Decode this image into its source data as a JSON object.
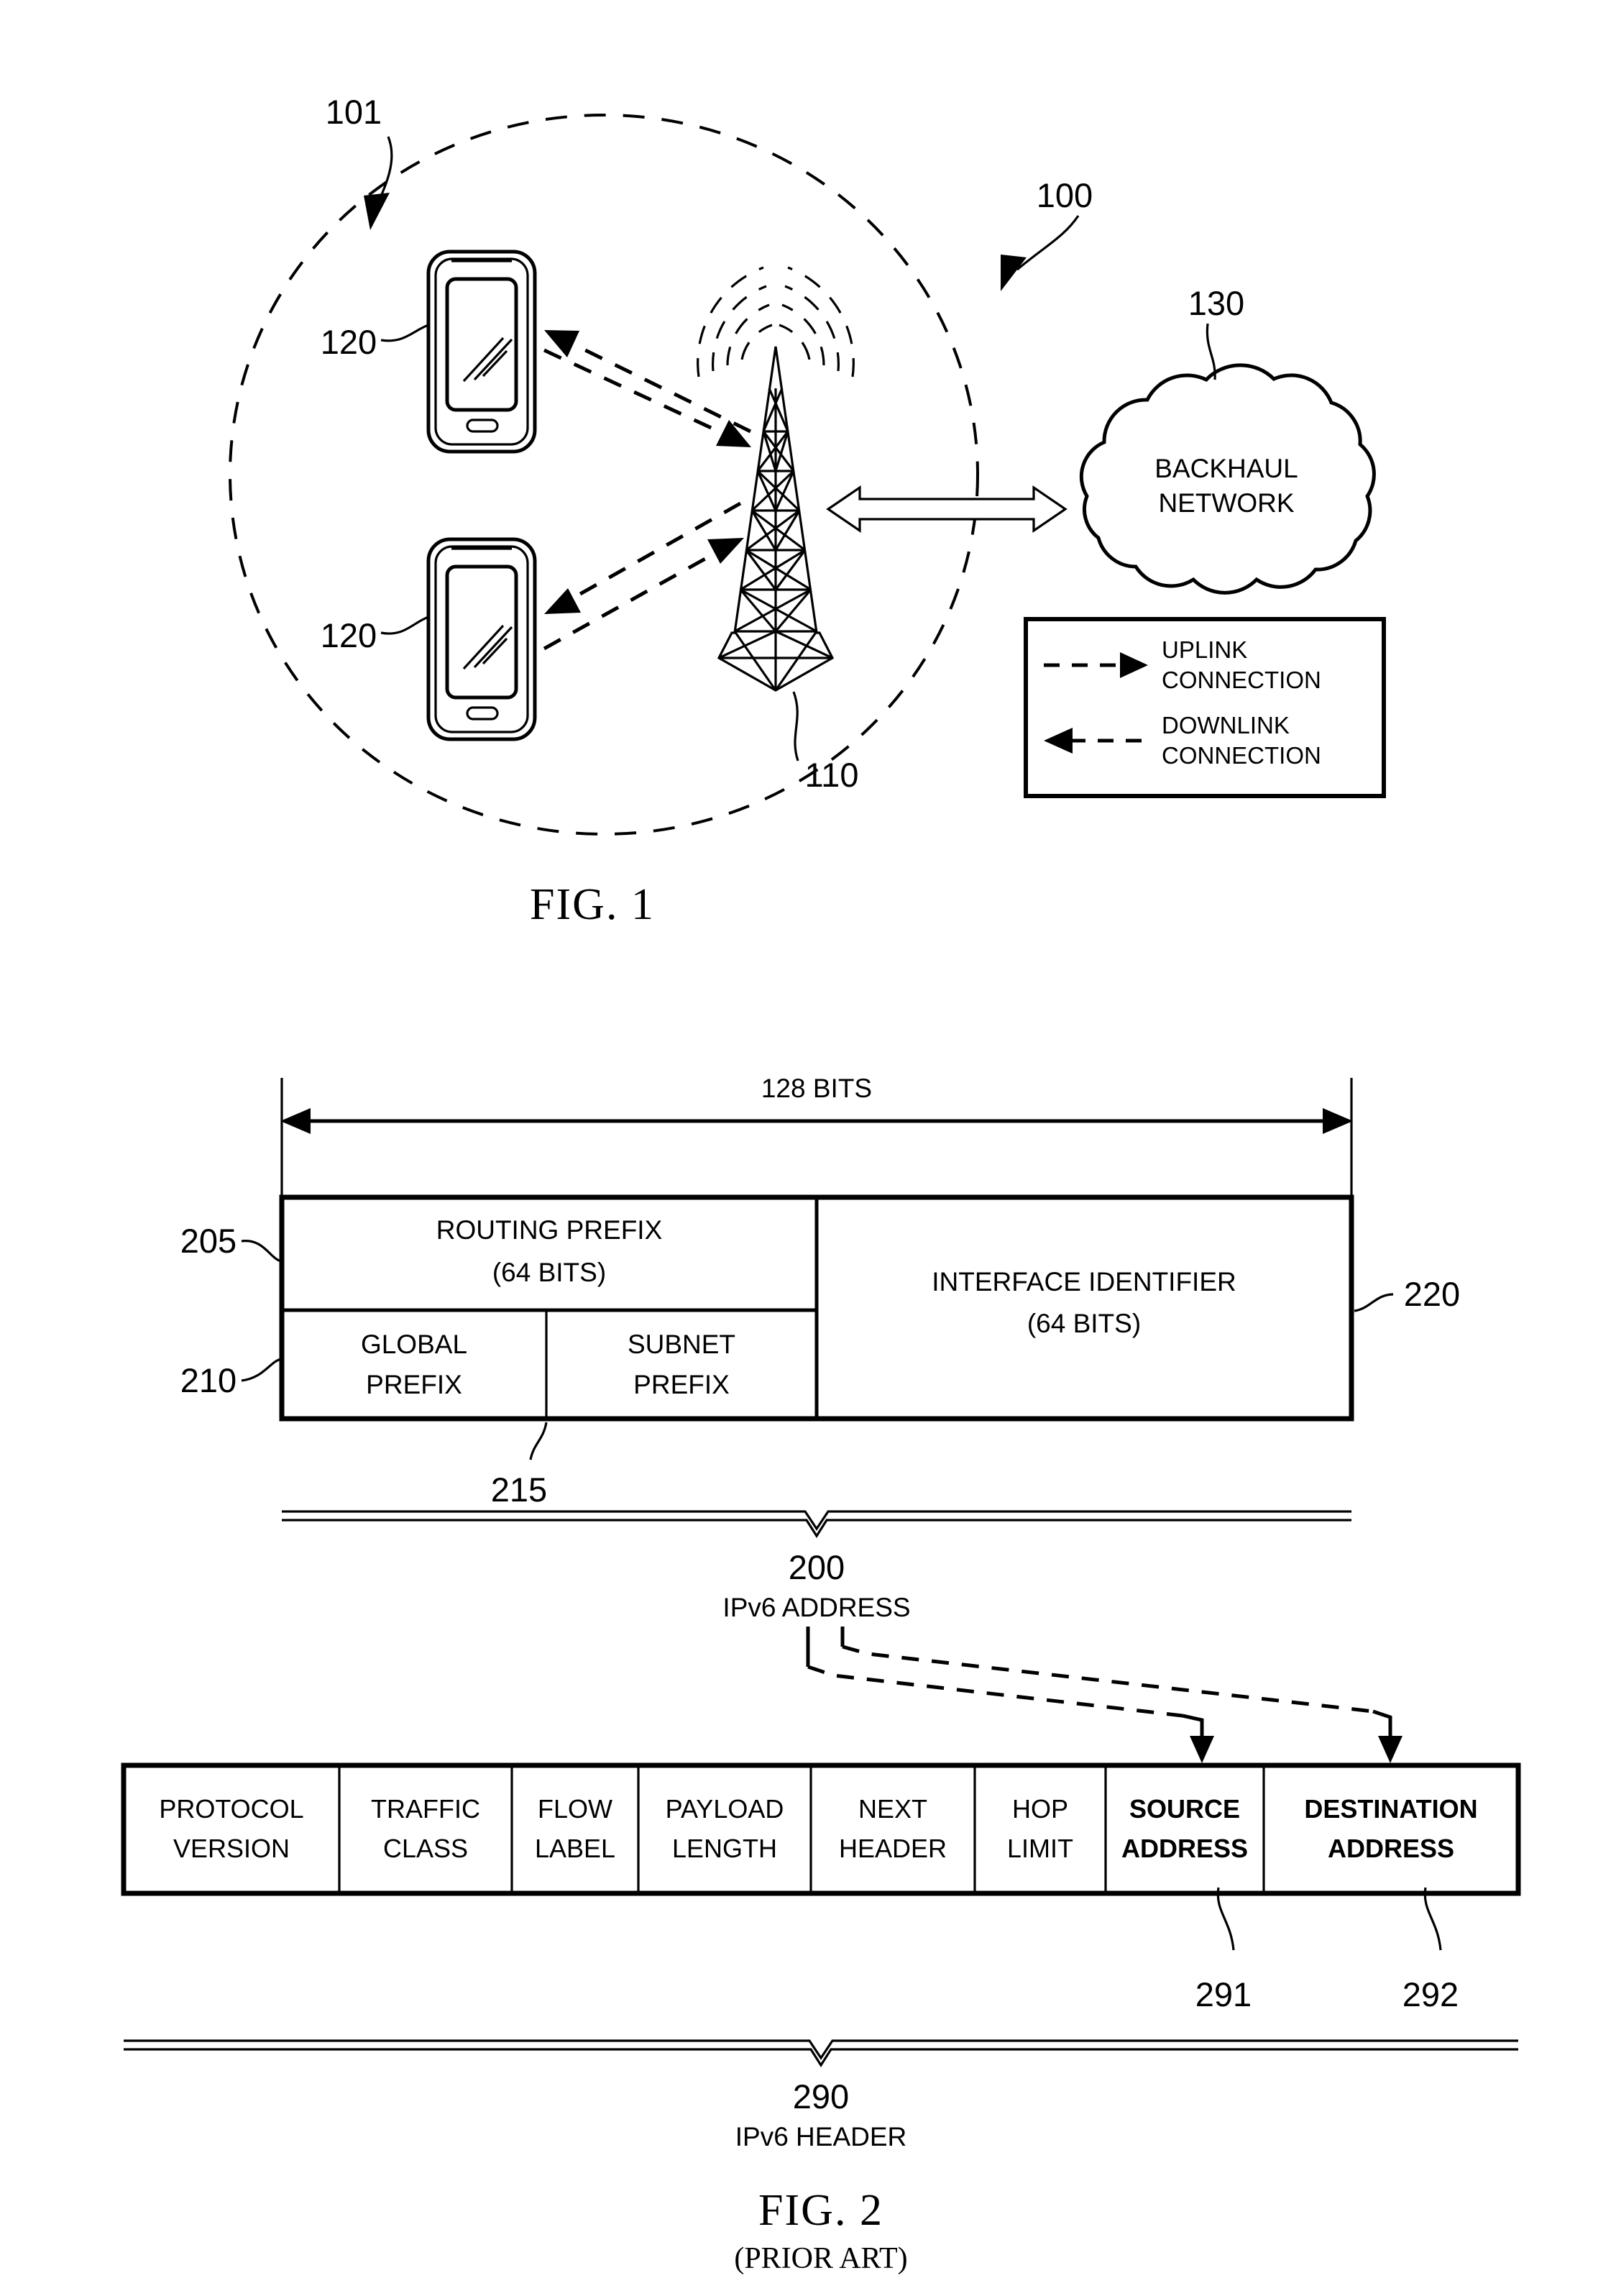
{
  "document": {
    "type": "patent-drawing-sheet",
    "figures": [
      {
        "id": "fig1",
        "caption": "FIG. 1",
        "subcaption": ""
      },
      {
        "id": "fig2",
        "caption": "FIG. 2",
        "subcaption": "(PRIOR ART)"
      }
    ]
  },
  "fig1": {
    "caption": "FIG. 1",
    "reference_numerals": {
      "system": "100",
      "cell_coverage": "101",
      "base_station": "110",
      "user_equipment_top": "120",
      "user_equipment_bottom": "120",
      "backhaul": "130"
    },
    "cloud_label_line1": "BACKHAUL",
    "cloud_label_line2": "NETWORK",
    "legend": {
      "items": [
        {
          "line1": "UPLINK",
          "line2": "CONNECTION",
          "direction": "right"
        },
        {
          "line1": "DOWNLINK",
          "line2": "CONNECTION",
          "direction": "left"
        }
      ]
    }
  },
  "fig2": {
    "caption": "FIG. 2",
    "subcaption": "(PRIOR ART)",
    "dimension_label": "128 BITS",
    "address_block": {
      "reference_numerals": {
        "routing_prefix": "205",
        "global_prefix": "210",
        "subnet_prefix": "215",
        "interface_identifier": "220",
        "whole": "200"
      },
      "cells": {
        "routing_prefix_line1": "ROUTING PREFIX",
        "routing_prefix_line2": "(64 BITS)",
        "global_prefix_line1": "GLOBAL",
        "global_prefix_line2": "PREFIX",
        "subnet_prefix_line1": "SUBNET",
        "subnet_prefix_line2": "PREFIX",
        "interface_id_line1": "INTERFACE IDENTIFIER",
        "interface_id_line2": "(64 BITS)"
      },
      "brace_number": "200",
      "brace_label": "IPv6 ADDRESS"
    },
    "header_block": {
      "brace_number": "290",
      "brace_label": "IPv6 HEADER",
      "reference_numerals": {
        "source_address": "291",
        "destination_address": "292"
      },
      "fields": [
        {
          "line1": "PROTOCOL",
          "line2": "VERSION",
          "bold": false
        },
        {
          "line1": "TRAFFIC",
          "line2": "CLASS",
          "bold": false
        },
        {
          "line1": "FLOW",
          "line2": "LABEL",
          "bold": false
        },
        {
          "line1": "PAYLOAD",
          "line2": "LENGTH",
          "bold": false
        },
        {
          "line1": "NEXT",
          "line2": "HEADER",
          "bold": false
        },
        {
          "line1": "HOP",
          "line2": "LIMIT",
          "bold": false
        },
        {
          "line1": "SOURCE",
          "line2": "ADDRESS",
          "bold": true
        },
        {
          "line1": "DESTINATION",
          "line2": "ADDRESS",
          "bold": true
        }
      ]
    }
  },
  "colors": {
    "ink": "#000000",
    "paper": "#ffffff"
  }
}
